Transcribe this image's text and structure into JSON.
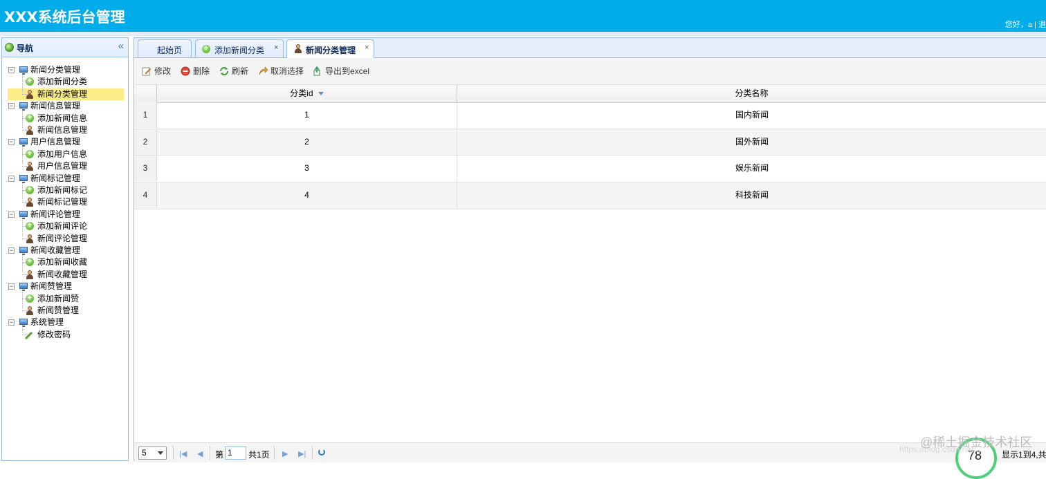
{
  "header": {
    "title": "XXX系统后台管理",
    "user_info": "您好，a | 退"
  },
  "sidebar": {
    "title": "导航",
    "groups": [
      {
        "label": "新闻分类管理",
        "children": [
          "添加新闻分类",
          "新闻分类管理"
        ]
      },
      {
        "label": "新闻信息管理",
        "children": [
          "添加新闻信息",
          "新闻信息管理"
        ]
      },
      {
        "label": "用户信息管理",
        "children": [
          "添加用户信息",
          "用户信息管理"
        ]
      },
      {
        "label": "新闻标记管理",
        "children": [
          "添加新闻标记",
          "新闻标记管理"
        ]
      },
      {
        "label": "新闻评论管理",
        "children": [
          "添加新闻评论",
          "新闻评论管理"
        ]
      },
      {
        "label": "新闻收藏管理",
        "children": [
          "添加新闻收藏",
          "新闻收藏管理"
        ]
      },
      {
        "label": "新闻赞管理",
        "children": [
          "添加新闻赞",
          "新闻赞管理"
        ]
      },
      {
        "label": "系统管理",
        "children": [
          "修改密码"
        ]
      }
    ],
    "selected": "新闻分类管理"
  },
  "tabs": [
    {
      "label": "起始页",
      "icon": "none"
    },
    {
      "label": "添加新闻分类",
      "icon": "add-circle-icon"
    },
    {
      "label": "新闻分类管理",
      "icon": "person-icon",
      "active": true
    }
  ],
  "toolbar": {
    "edit": "修改",
    "delete": "删除",
    "refresh": "刷新",
    "cancel_select": "取消选择",
    "export": "导出到excel"
  },
  "grid": {
    "columns": [
      "分类id",
      "分类名称"
    ],
    "sort_indicator": "descending",
    "rows": [
      {
        "num": "1",
        "id": "1",
        "name": "国内新闻"
      },
      {
        "num": "2",
        "id": "2",
        "name": "国外新闻"
      },
      {
        "num": "3",
        "id": "3",
        "name": "娱乐新闻"
      },
      {
        "num": "4",
        "id": "4",
        "name": "科技新闻"
      }
    ]
  },
  "pager": {
    "page_size": "5",
    "page_prefix": "第",
    "page_value": "1",
    "page_total": "共1页",
    "info": "显示1到4,共",
    "gauge_value": "78"
  },
  "watermark": {
    "text": "@稀土掘金技术社区",
    "url": "https://blog.csdn.net/..."
  },
  "colors": {
    "header": "#00acea",
    "border": "#95b8e7",
    "selected": "#fbec88"
  }
}
